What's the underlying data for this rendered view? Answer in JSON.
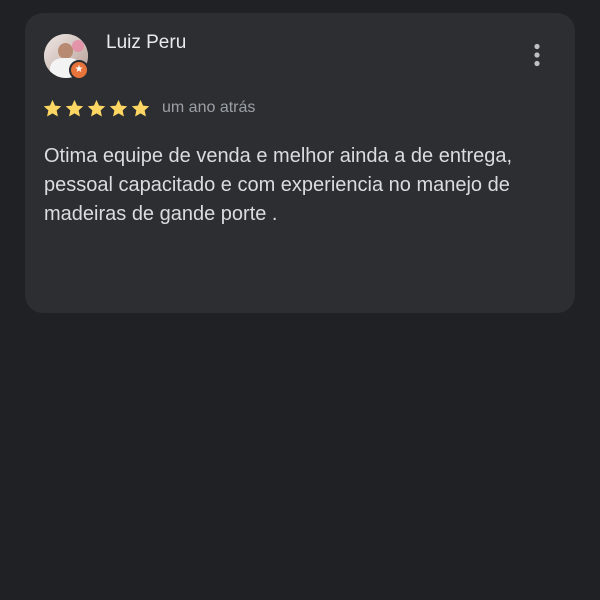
{
  "review": {
    "reviewer_name": "Luiz Peru",
    "rating": 5,
    "max_rating": 5,
    "date": "um ano atrás",
    "text": "Otima equipe de venda e melhor ainda a de entrega, pessoal capacitado e com experiencia no manejo de madeiras de gande porte .",
    "badge_icon": "local-guide-star-icon",
    "more_icon": "more-vertical-icon"
  },
  "colors": {
    "background": "#202124",
    "card": "#2d2e31",
    "star": "#fdd663",
    "badge": "#e8743b",
    "name_text": "#e8eaed",
    "secondary_text": "#9aa0a6",
    "body_text": "#dadce0"
  }
}
